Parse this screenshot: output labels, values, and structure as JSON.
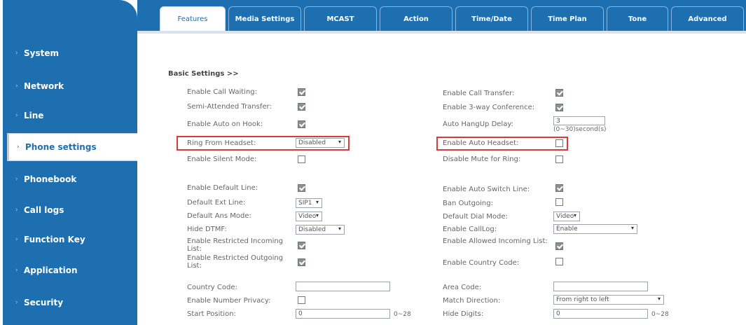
{
  "sidebar": {
    "items": [
      {
        "label": "System"
      },
      {
        "label": "Network"
      },
      {
        "label": "Line"
      },
      {
        "label": "Phone settings"
      },
      {
        "label": "Phonebook"
      },
      {
        "label": "Call logs"
      },
      {
        "label": "Function Key"
      },
      {
        "label": "Application"
      },
      {
        "label": "Security"
      }
    ]
  },
  "tabs": [
    {
      "label": "Features"
    },
    {
      "label": "Media Settings"
    },
    {
      "label": "MCAST"
    },
    {
      "label": "Action"
    },
    {
      "label": "Time/Date"
    },
    {
      "label": "Time Plan"
    },
    {
      "label": "Tone"
    },
    {
      "label": "Advanced"
    }
  ],
  "section": {
    "title": "Basic Settings >>"
  },
  "left": {
    "call_waiting": {
      "label": "Enable Call Waiting:",
      "checked": true
    },
    "semi_attended": {
      "label": "Semi-Attended Transfer:",
      "checked": true
    },
    "auto_on_hook": {
      "label": "Enable Auto on Hook:",
      "checked": true
    },
    "ring_from_headset": {
      "label": "Ring From Headset:",
      "value": "Disabled"
    },
    "silent_mode": {
      "label": "Enable Silent Mode:",
      "checked": false
    },
    "default_line": {
      "label": "Enable Default Line:",
      "checked": true
    },
    "default_ext_line": {
      "label": "Default Ext Line:",
      "value": "SIP1"
    },
    "default_ans_mode": {
      "label": "Default Ans Mode:",
      "value": "Video"
    },
    "hide_dtmf": {
      "label": "Hide DTMF:",
      "value": "Disabled"
    },
    "restricted_incoming": {
      "label": "Enable Restricted Incoming List:",
      "checked": true
    },
    "restricted_outgoing": {
      "label": "Enable Restricted Outgoing List:",
      "checked": true
    },
    "country_code": {
      "label": "Country Code:",
      "value": ""
    },
    "number_privacy": {
      "label": "Enable Number Privacy:",
      "checked": false
    },
    "start_position": {
      "label": "Start Position:",
      "value": "0",
      "hint": "0~28"
    }
  },
  "right": {
    "call_transfer": {
      "label": "Enable Call Transfer:",
      "checked": true
    },
    "three_way": {
      "label": "Enable 3-way Conference:",
      "checked": true
    },
    "auto_hangup_delay": {
      "label": "Auto HangUp Delay:",
      "value": "3",
      "hint": "(0~30)second(s)"
    },
    "auto_headset": {
      "label": "Enable Auto Headset:",
      "checked": false
    },
    "disable_mute_ring": {
      "label": "Disable Mute for Ring:",
      "checked": false
    },
    "auto_switch_line": {
      "label": "Enable Auto Switch Line:",
      "checked": true
    },
    "ban_outgoing": {
      "label": "Ban Outgoing:",
      "checked": false
    },
    "default_dial_mode": {
      "label": "Default Dial Mode:",
      "value": "Video"
    },
    "call_log": {
      "label": "Enable CallLog:",
      "value": "Enable"
    },
    "allowed_incoming": {
      "label": "Enable Allowed Incoming List:",
      "checked": true
    },
    "country_code_enable": {
      "label": "Enable Country Code:",
      "checked": false
    },
    "area_code": {
      "label": "Area Code:",
      "value": ""
    },
    "match_direction": {
      "label": "Match Direction:",
      "value": "From right to left"
    },
    "hide_digits": {
      "label": "Hide Digits:",
      "value": "0",
      "hint": "0~28"
    }
  },
  "colors": {
    "primary": "#1e6fb0",
    "highlight": "#d93a3a"
  }
}
